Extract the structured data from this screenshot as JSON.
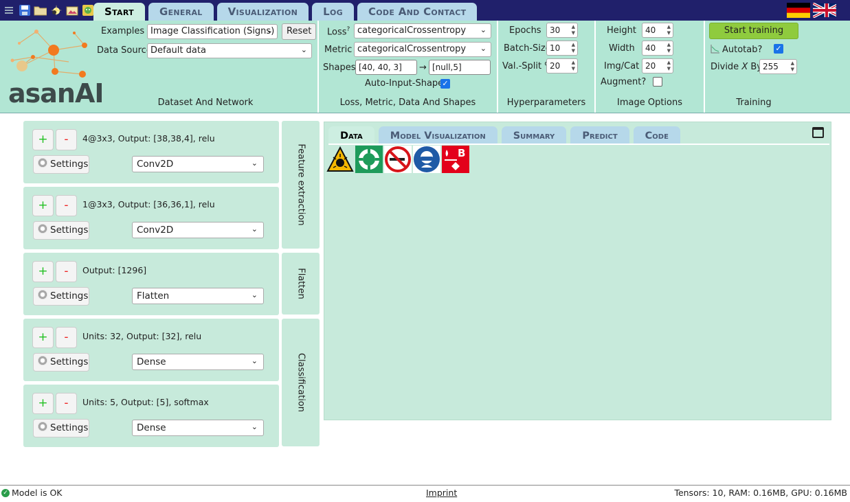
{
  "tabs": [
    "Start",
    "General",
    "Visualization",
    "Log",
    "Code And Contact"
  ],
  "quick_icons": [
    "menu-icon",
    "save-icon",
    "folder-icon",
    "sparkle-icon",
    "image-upload-icon",
    "cartoon-icon"
  ],
  "languages": [
    "de",
    "en"
  ],
  "logo": {
    "text": "asanAI"
  },
  "dataset": {
    "examples_label": "Examples",
    "examples_value": "Image Classification (Signs)",
    "reset_label": "Reset",
    "source_label": "Data Source",
    "source_value": "Default data",
    "group_title": "Dataset And Network"
  },
  "loss": {
    "loss_label": "Loss",
    "loss_sup": "?",
    "loss_value": "categoricalCrossentropy",
    "metric_label": "Metric",
    "metric_value": "categoricalCrossentropy",
    "shapes_label": "Shapes",
    "input_shape": "[40, 40, 3]",
    "arrow": "→",
    "output_shape": "[null,5]",
    "auto_shape_label": "Auto-Input-Shape?",
    "auto_shape_checked": true,
    "group_title": "Loss, Metric, Data And Shapes"
  },
  "hyper": {
    "epochs_label": "Epochs",
    "epochs_value": "30",
    "batch_label": "Batch-Size",
    "batch_value": "10",
    "split_label": "Val.-Split %",
    "split_value": "20",
    "group_title": "Hyperparameters"
  },
  "image_opts": {
    "height_label": "Height",
    "height_value": "40",
    "width_label": "Width",
    "width_value": "40",
    "imgcat_label": "Img/Cat",
    "imgcat_value": "20",
    "augment_label": "Augment?",
    "augment_checked": false,
    "group_title": "Image Options"
  },
  "training": {
    "start_label": "Start training",
    "autotab_label": "Autotab?",
    "autotab_checked": true,
    "divide_label_pre": "Divide ",
    "divide_label_x": "X",
    "divide_label_post": " By:",
    "divide_value": "255",
    "group_title": "Training"
  },
  "layers": [
    {
      "desc": "4@3x3, Output: [38,38,4], relu",
      "type": "Conv2D"
    },
    {
      "desc": "1@3x3, Output: [36,36,1], relu",
      "type": "Conv2D"
    },
    {
      "desc": "Output: [1296]",
      "type": "Flatten"
    },
    {
      "desc": "Units: 32, Output: [32], relu",
      "type": "Dense"
    },
    {
      "desc": "Units: 5, Output: [5], softmax",
      "type": "Dense"
    }
  ],
  "layer_buttons": {
    "plus": "+",
    "minus": "-",
    "settings": "Settings"
  },
  "layer_groups": [
    "Feature extraction",
    "Flatten",
    "Classification"
  ],
  "panel_tabs": [
    "Data",
    "Model Visualization",
    "Summary",
    "Predict",
    "Code"
  ],
  "data_images": [
    "explosive-warning-sign",
    "lifebuoy-sign",
    "no-smoking-sign",
    "eye-protection-sign",
    "fire-class-b-sign"
  ],
  "status": {
    "model_status": "Model is OK",
    "imprint": "Imprint",
    "resources": "Tensors: 10, RAM: 0.16MB, GPU: 0.16MB"
  },
  "colors": {
    "topbar": "#20206b",
    "ribbon": "#b2e6d4",
    "panel": "#c7eadb",
    "start_button": "#8fcb3e",
    "tab_inactive": "#b6d8ea"
  }
}
